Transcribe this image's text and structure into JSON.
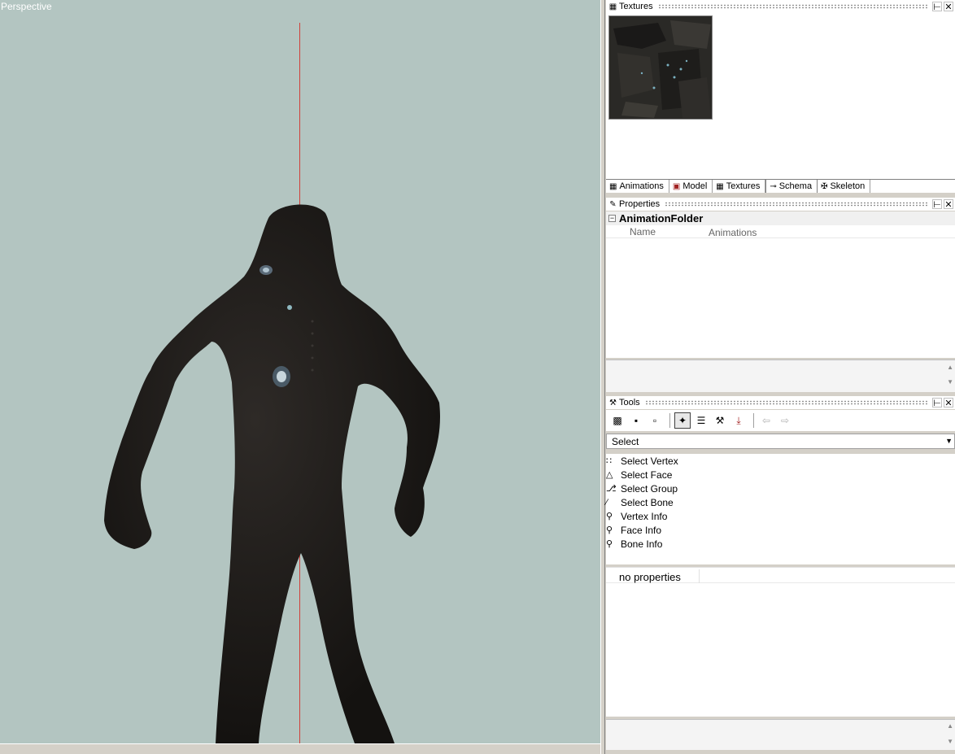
{
  "viewport": {
    "label": "Perspective",
    "background": "#b3c5c1",
    "axis_color": "#d0403a"
  },
  "textures_panel": {
    "title": "Textures",
    "pin_icon": "pin-icon",
    "close_icon": "close-icon"
  },
  "tabs": [
    {
      "label": "Animations",
      "icon": "animations-icon"
    },
    {
      "label": "Model",
      "icon": "model-icon"
    },
    {
      "label": "Textures",
      "icon": "textures-icon"
    },
    {
      "label": "Schema",
      "icon": "schema-icon"
    },
    {
      "label": "Skeleton",
      "icon": "skeleton-icon"
    }
  ],
  "properties_panel": {
    "title": "Properties",
    "group": "AnimationFolder",
    "rows": [
      {
        "name": "Name",
        "value": "Animations"
      }
    ]
  },
  "tools_panel": {
    "title": "Tools",
    "select_value": "Select",
    "items": [
      {
        "label": "Select Vertex",
        "icon": "select-vertex-icon"
      },
      {
        "label": "Select Face",
        "icon": "select-face-icon"
      },
      {
        "label": "Select Group",
        "icon": "select-group-icon"
      },
      {
        "label": "Select Bone",
        "icon": "select-bone-icon"
      },
      {
        "label": "Vertex Info",
        "icon": "vertex-info-icon"
      },
      {
        "label": "Face Info",
        "icon": "face-info-icon"
      },
      {
        "label": "Bone Info",
        "icon": "bone-info-icon"
      }
    ],
    "no_properties": "no properties"
  }
}
